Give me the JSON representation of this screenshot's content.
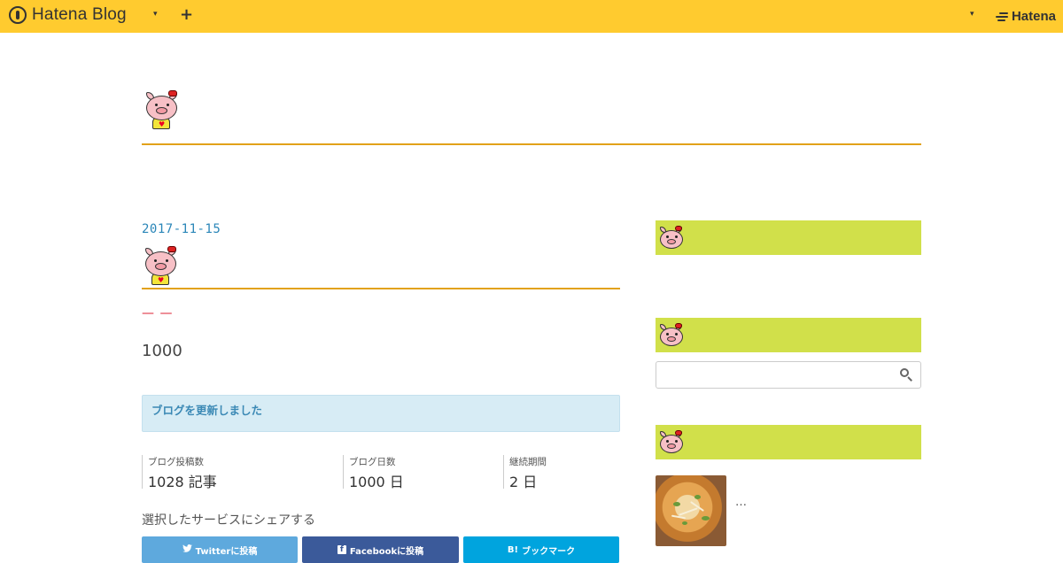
{
  "topbar": {
    "brand": "Hatena Blog",
    "caret": "▾",
    "plus": "+",
    "right_caret": "▾",
    "right_brand": "Hatena",
    "bg_color": "#ffcb2f"
  },
  "entry": {
    "date": "2017-11-15",
    "dashes": "— —",
    "number": "1000",
    "notice": "ブログを更新しました"
  },
  "stats": [
    {
      "label": "ブログ投稿数",
      "value": "1028 記事"
    },
    {
      "label": "ブログ日数",
      "value": "1000 日"
    },
    {
      "label": "継続期間",
      "value": "2 日"
    }
  ],
  "share": {
    "heading": "選択したサービスにシェアする",
    "twitter": {
      "icon": "🐦",
      "label": "Twitterに投稿"
    },
    "facebook": {
      "icon": "f",
      "label": "Facebookに投稿"
    },
    "hatebu": {
      "icon": "B!",
      "label": "ブックマーク"
    }
  },
  "sidebar": {
    "search_placeholder": "",
    "ellipsis": "…",
    "head_color": "#d1e04a"
  },
  "icons": {
    "pig": "pig-mascot-icon",
    "search": "search-icon"
  }
}
